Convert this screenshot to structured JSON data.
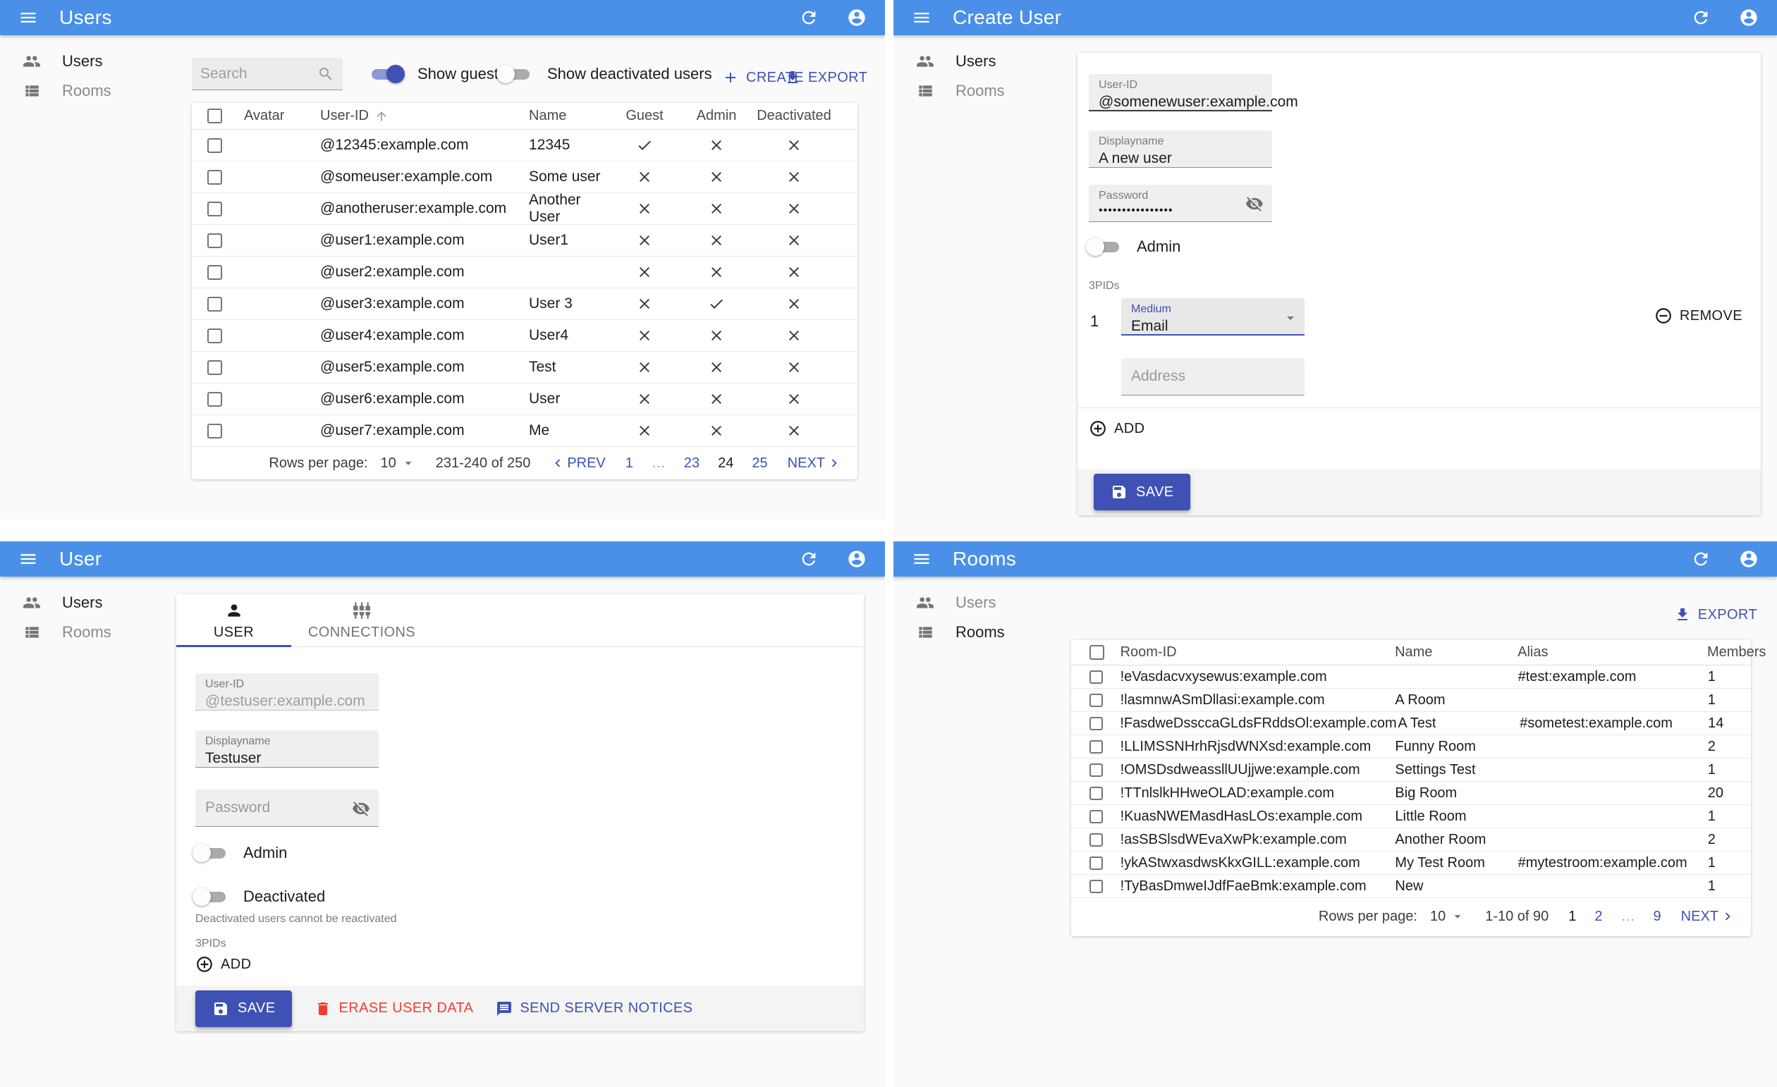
{
  "colors": {
    "appbar_blue": "#4a90e9",
    "primary_indigo": "#3f51b5",
    "danger_red": "#f23d32",
    "page_bg": "#fafafa"
  },
  "sidebar": {
    "users_label": "Users",
    "rooms_label": "Rooms"
  },
  "panels": {
    "users_list": {
      "appbar_title": "Users",
      "search_placeholder": "Search",
      "show_guests_label": "Show guests",
      "show_deactivated_label": "Show deactivated users",
      "create_label": "CREATE",
      "export_label": "EXPORT",
      "table": {
        "headers": {
          "avatar": "Avatar",
          "user_id": "User-ID",
          "name": "Name",
          "guest": "Guest",
          "admin": "Admin",
          "deactivated": "Deactivated"
        },
        "rows": [
          {
            "user_id": "@12345:example.com",
            "name": "12345",
            "guest": true,
            "admin": false,
            "deactivated": false
          },
          {
            "user_id": "@someuser:example.com",
            "name": "Some user",
            "guest": false,
            "admin": false,
            "deactivated": false
          },
          {
            "user_id": "@anotheruser:example.com",
            "name": "Another User",
            "guest": false,
            "admin": false,
            "deactivated": false
          },
          {
            "user_id": "@user1:example.com",
            "name": "User1",
            "guest": false,
            "admin": false,
            "deactivated": false
          },
          {
            "user_id": "@user2:example.com",
            "name": "",
            "guest": false,
            "admin": false,
            "deactivated": false
          },
          {
            "user_id": "@user3:example.com",
            "name": "User 3",
            "guest": false,
            "admin": true,
            "deactivated": false
          },
          {
            "user_id": "@user4:example.com",
            "name": "User4",
            "guest": false,
            "admin": false,
            "deactivated": false
          },
          {
            "user_id": "@user5:example.com",
            "name": "Test",
            "guest": false,
            "admin": false,
            "deactivated": false
          },
          {
            "user_id": "@user6:example.com",
            "name": "User",
            "guest": false,
            "admin": false,
            "deactivated": false
          },
          {
            "user_id": "@user7:example.com",
            "name": "Me",
            "guest": false,
            "admin": false,
            "deactivated": false
          }
        ]
      },
      "pagination": {
        "rows_per_page_label": "Rows per page:",
        "rows_per_page": "10",
        "range": "231-240 of 250",
        "prev_label": "PREV",
        "next_label": "NEXT",
        "pages": [
          {
            "label": "1"
          },
          {
            "label": "…",
            "ellipsis": true
          },
          {
            "label": "23"
          },
          {
            "label": "24",
            "current": true
          },
          {
            "label": "25"
          }
        ]
      }
    },
    "create_user": {
      "appbar_title": "Create User",
      "fields": {
        "user_id": {
          "label": "User-ID",
          "value": "@somenewuser:example.com"
        },
        "displayname": {
          "label": "Displayname",
          "value": "A new user"
        },
        "password": {
          "label": "Password",
          "value": "••••••••••••••••"
        }
      },
      "admin_toggle_label": "Admin",
      "threepids": {
        "section_label": "3PIDs",
        "row_index": "1",
        "medium_label": "Medium",
        "medium_value": "Email",
        "address_placeholder": "Address",
        "remove_label": "REMOVE",
        "add_label": "ADD"
      },
      "save_label": "SAVE"
    },
    "user_edit": {
      "appbar_title": "User",
      "tabs": {
        "user": "USER",
        "connections": "CONNECTIONS"
      },
      "fields": {
        "user_id": {
          "label": "User-ID",
          "value": "@testuser:example.com"
        },
        "displayname": {
          "label": "Displayname",
          "value": "Testuser"
        },
        "password_placeholder": "Password"
      },
      "admin_toggle_label": "Admin",
      "deactivated_toggle_label": "Deactivated",
      "deactivated_helper": "Deactivated users cannot be reactivated",
      "threepids_label": "3PIDs",
      "add_label": "ADD",
      "save_label": "SAVE",
      "erase_label": "ERASE USER DATA",
      "notices_label": "SEND SERVER NOTICES"
    },
    "rooms_list": {
      "appbar_title": "Rooms",
      "export_label": "EXPORT",
      "table": {
        "headers": {
          "room_id": "Room-ID",
          "name": "Name",
          "alias": "Alias",
          "members": "Members"
        },
        "rows": [
          {
            "room_id": "!eVasdacvxysewus:example.com",
            "name": "",
            "alias": "#test:example.com",
            "members": "1"
          },
          {
            "room_id": "!lasmnwASmDllasi:example.com",
            "name": "A Room",
            "alias": "",
            "members": "1"
          },
          {
            "room_id": "!FasdweDssccaGLdsFRddsOl:example.com",
            "name": "A Test",
            "alias": "#sometest:example.com",
            "members": "14"
          },
          {
            "room_id": "!LLIMSSNHrhRjsdWNXsd:example.com",
            "name": "Funny Room",
            "alias": "",
            "members": "2"
          },
          {
            "room_id": "!OMSDsdweassllUUjjwe:example.com",
            "name": "Settings Test",
            "alias": "",
            "members": "1"
          },
          {
            "room_id": "!TTnlslkHHweOLAD:example.com",
            "name": "Big Room",
            "alias": "",
            "members": "20"
          },
          {
            "room_id": "!KuasNWEMasdHasLOs:example.com",
            "name": "Little Room",
            "alias": "",
            "members": "1"
          },
          {
            "room_id": "!asSBSlsdWEvaXwPk:example.com",
            "name": "Another Room",
            "alias": "",
            "members": "2"
          },
          {
            "room_id": "!ykAStwxasdwsKkxGILL:example.com",
            "name": "My Test Room",
            "alias": "#mytestroom:example.com",
            "members": "1"
          },
          {
            "room_id": "!TyBasDmweIJdfFaeBmk:example.com",
            "name": "New",
            "alias": "",
            "members": "1"
          }
        ]
      },
      "pagination": {
        "rows_per_page_label": "Rows per page:",
        "rows_per_page": "10",
        "range": "1-10 of 90",
        "next_label": "NEXT",
        "pages": [
          {
            "label": "1",
            "current": true
          },
          {
            "label": "2"
          },
          {
            "label": "…",
            "ellipsis": true
          },
          {
            "label": "9"
          }
        ]
      }
    }
  }
}
